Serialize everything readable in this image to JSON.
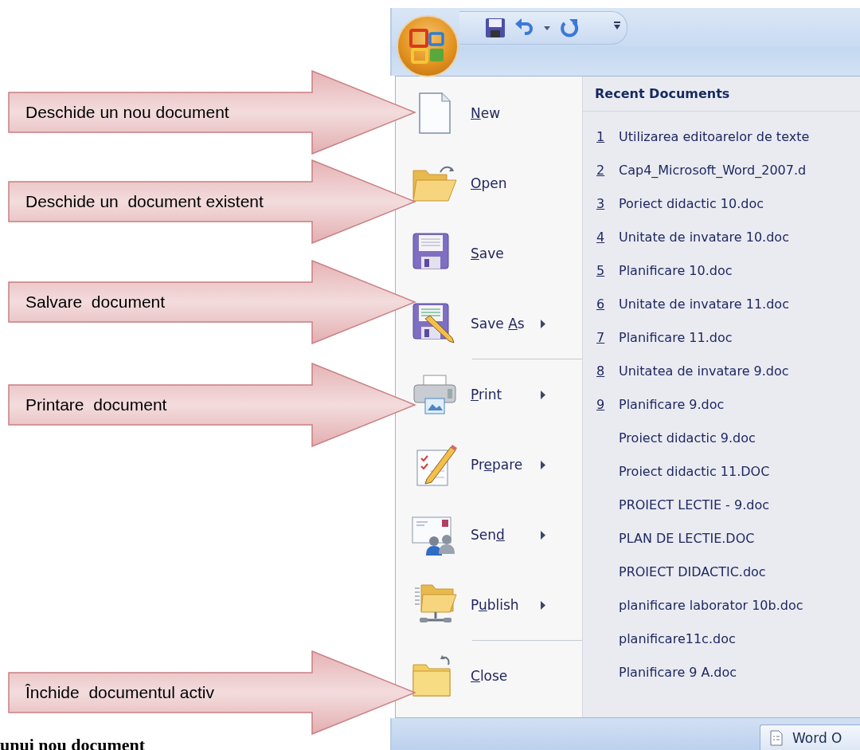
{
  "callouts": [
    {
      "text": "Deschide un nou document"
    },
    {
      "text": "Deschide un  document existent"
    },
    {
      "text": "Salvare  document"
    },
    {
      "text": "Printare  document"
    },
    {
      "text": "Închide  documentul activ"
    }
  ],
  "office_menu": {
    "commands": [
      {
        "key": "N",
        "after": "ew",
        "submenu": false,
        "separator_before": false
      },
      {
        "key": "O",
        "after": "pen",
        "submenu": false,
        "separator_before": false
      },
      {
        "key": "S",
        "after": "ave",
        "submenu": false,
        "separator_before": false
      },
      {
        "before": "Save ",
        "key": "A",
        "after": "s",
        "submenu": true,
        "separator_before": false
      },
      {
        "key": "P",
        "after": "rint",
        "submenu": true,
        "separator_before": true
      },
      {
        "before": "Pr",
        "key": "e",
        "after": "pare",
        "submenu": true,
        "separator_before": false
      },
      {
        "before": "Sen",
        "key": "d",
        "submenu": true,
        "separator_before": false
      },
      {
        "before": "P",
        "key": "u",
        "after": "blish",
        "submenu": true,
        "separator_before": false
      },
      {
        "key": "C",
        "after": "lose",
        "submenu": false,
        "separator_before": true
      }
    ],
    "recent_title": "Recent Documents",
    "recent_documents": [
      {
        "number": "1",
        "name": "Utilizarea editoarelor de texte"
      },
      {
        "number": "2",
        "name": "Cap4_Microsoft_Word_2007.d"
      },
      {
        "number": "3",
        "name": "Poriect didactic 10.doc"
      },
      {
        "number": "4",
        "name": "Unitate de invatare 10.doc"
      },
      {
        "number": "5",
        "name": "Planificare 10.doc"
      },
      {
        "number": "6",
        "name": "Unitate de invatare 11.doc"
      },
      {
        "number": "7",
        "name": "Planificare 11.doc"
      },
      {
        "number": "8",
        "name": "Unitatea de invatare 9.doc"
      },
      {
        "number": "9",
        "name": "Planificare 9.doc"
      },
      {
        "name": "Proiect didactic 9.doc"
      },
      {
        "name": "Proiect didactic 11.DOC"
      },
      {
        "name": "PROIECT LECTIE - 9.doc"
      },
      {
        "name": "PLAN DE LECTIE.DOC"
      },
      {
        "name": "PROIECT DIDACTIC.doc"
      },
      {
        "name": "planificare laborator 10b.doc"
      },
      {
        "name": "planificare11c.doc"
      },
      {
        "name": "Planificare 9 A.doc"
      }
    ]
  },
  "taskbar": {
    "button": "Word O"
  },
  "caption": "unui nou document"
}
